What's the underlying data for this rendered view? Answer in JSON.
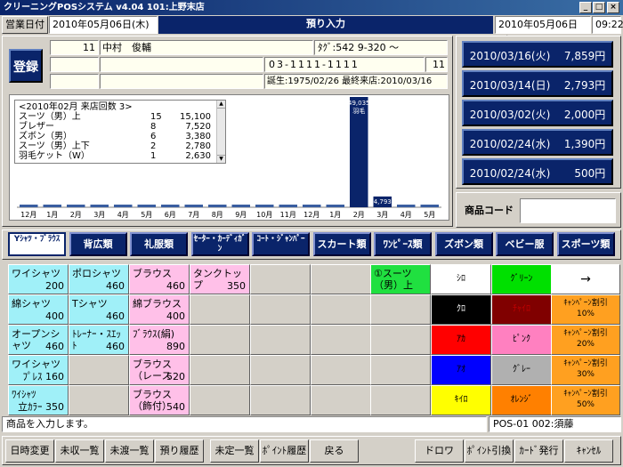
{
  "window": {
    "title": "クリーニングPOSシステム v4.04  101:上野末店",
    "minimize": "_",
    "maximize": "□",
    "close": "×"
  },
  "infobar": {
    "biz_date_label": "営業日付",
    "biz_date": "2010年05月06日(木)",
    "screen_title": "預り入力",
    "today": "2010年05月06日(木)",
    "time": "09:22"
  },
  "customer": {
    "register_label": "登録",
    "id": "11",
    "name": "中村　俊輔",
    "tag": "ﾀｸﾞ:542 9-320 ～",
    "phone": "03-1111-1111",
    "phone_suffix": "11",
    "info": "誕生:1975/02/26 最終来店:2010/03/16"
  },
  "visits": {
    "header": "<2010年02月  来店回数  3>",
    "rows": [
      {
        "item": "スーツ（男）上",
        "qty": "15",
        "amount": "15,100"
      },
      {
        "item": "ブレザー",
        "qty": "8",
        "amount": "7,520"
      },
      {
        "item": "ズボン（男）",
        "qty": "6",
        "amount": "3,380"
      },
      {
        "item": "スーツ（男）上下",
        "qty": "2",
        "amount": "2,780"
      },
      {
        "item": "羽毛ケット（W）",
        "qty": "1",
        "amount": "2,630"
      }
    ]
  },
  "chart_data": {
    "type": "bar",
    "categories": [
      "12月",
      "1月",
      "2月",
      "3月",
      "4月",
      "5月",
      "6月",
      "7月",
      "8月",
      "9月",
      "10月",
      "11月",
      "12月",
      "1月",
      "2月",
      "3月",
      "4月",
      "5月"
    ],
    "values": [
      0,
      0,
      0,
      0,
      0,
      0,
      0,
      0,
      0,
      0,
      0,
      0,
      0,
      0,
      49035,
      4793,
      0,
      0
    ],
    "bar_labels": {
      "14": "49,035",
      "15": "4,793"
    },
    "annotation": {
      "14": "羽毛"
    },
    "ylim": [
      0,
      49035
    ]
  },
  "history": [
    {
      "date": "2010/03/16(火)",
      "amount": "7,859円"
    },
    {
      "date": "2010/03/14(日)",
      "amount": "2,793円"
    },
    {
      "date": "2010/03/02(火)",
      "amount": "2,000円"
    },
    {
      "date": "2010/02/24(水)",
      "amount": "1,390円"
    },
    {
      "date": "2010/02/24(水)",
      "amount": "500円"
    }
  ],
  "product_code": {
    "label": "商品コード",
    "value": ""
  },
  "categories": [
    {
      "label": "Yｼｬﾂ・ﾌﾞﾗｳｽ",
      "active": true,
      "small": true
    },
    {
      "label": "背広類"
    },
    {
      "label": "礼服類"
    },
    {
      "label": "ｾｰﾀｰ・ｶｰﾃﾞｨｶﾞﾝ",
      "small": true
    },
    {
      "label": "ｺｰﾄ・ｼﾞｬﾝﾊﾟｰ",
      "small": true
    },
    {
      "label": "スカート類"
    },
    {
      "label": "ﾜﾝﾋﾟｰｽ類"
    },
    {
      "label": "ズボン類"
    },
    {
      "label": "ベビー服"
    },
    {
      "label": "スポーツ類"
    }
  ],
  "products": [
    {
      "label": "ワイシャツ",
      "price": "200",
      "color": "cyan"
    },
    {
      "label": "ポロシャツ",
      "price": "460",
      "color": "cyan"
    },
    {
      "label": "ブラウス",
      "price": "460",
      "color": "pink"
    },
    {
      "label": "タンクトップ",
      "price": "350",
      "color": "pink"
    },
    {
      "label": "綿シャツ",
      "price": "400",
      "color": "cyan"
    },
    {
      "label": "Tシャツ",
      "price": "460",
      "color": "cyan"
    },
    {
      "label": "綿ブラウス",
      "price": "400",
      "color": "pink"
    },
    {
      "label": "オープンシャツ",
      "price": "460",
      "color": "cyan"
    },
    {
      "label": "ﾄﾚｰﾅｰ・ｽｴｯﾄ",
      "price": "460",
      "color": "cyan"
    },
    {
      "label": "ﾌﾞﾗｳｽ(絹)",
      "price": "890",
      "color": "pink"
    },
    {
      "label": "ワイシャツ",
      "price": "ﾌﾟﾚｽ 160",
      "color": "cyan"
    },
    {
      "label": "ブラウス（レース",
      "price": "520",
      "color": "pink"
    },
    {
      "label": "ﾜｲｼｬﾂ",
      "price": "立ｶﾗｰ 350",
      "color": "cyan"
    },
    {
      "label": "ブラウス（飾付）",
      "price": "540",
      "color": "pink"
    }
  ],
  "suit_button": {
    "label": "①スーツ（男）上"
  },
  "colors": [
    {
      "label": "ｼﾛ",
      "bg": "#ffffff",
      "fg": "#000000"
    },
    {
      "label": "ｸﾞﾘｰﾝ",
      "bg": "#00e000",
      "fg": "#000000"
    },
    {
      "label": "ｸﾛ",
      "bg": "#000000",
      "fg": "#ffffff"
    },
    {
      "label": "ﾁｬｲﾛ",
      "bg": "#800000",
      "fg": "#c00000"
    },
    {
      "label": "ｱｶ",
      "bg": "#ff0000",
      "fg": "#000000"
    },
    {
      "label": "ﾋﾟﾝｸ",
      "bg": "#ff80c0",
      "fg": "#000000"
    },
    {
      "label": "ｱｵ",
      "bg": "#0000ff",
      "fg": "#000000"
    },
    {
      "label": "ｸﾞﾚｰ",
      "bg": "#b0b0b0",
      "fg": "#000000"
    },
    {
      "label": "ｷｲﾛ",
      "bg": "#ffff00",
      "fg": "#000000"
    },
    {
      "label": "ｵﾚﾝｼﾞ",
      "bg": "#ff8000",
      "fg": "#000000"
    }
  ],
  "side_buttons": [
    {
      "label": "→",
      "bg": "#ffffff"
    },
    {
      "label": "ｷｬﾝﾍﾟｰﾝ割引 10%",
      "bg": "#ffa020"
    },
    {
      "label": "ｷｬﾝﾍﾟｰﾝ割引 20%",
      "bg": "#ffa020"
    },
    {
      "label": "ｷｬﾝﾍﾟｰﾝ割引 30%",
      "bg": "#ffa020"
    },
    {
      "label": "ｷｬﾝﾍﾟｰﾝ割引 50%",
      "bg": "#ffa020"
    }
  ],
  "status": {
    "message": "商品を入力します。",
    "terminal": "POS-01 002:須藤"
  },
  "bottom_buttons": [
    "日時変更",
    "未収一覧",
    "未渡一覧",
    "預り履歴",
    "未定一覧",
    "ﾎﾟｲﾝﾄ履歴",
    "戻る",
    "ドロワ",
    "ﾎﾟｲﾝﾄ引換",
    "ｶｰﾄﾞ発行",
    "ｷｬﾝｾﾙ"
  ]
}
